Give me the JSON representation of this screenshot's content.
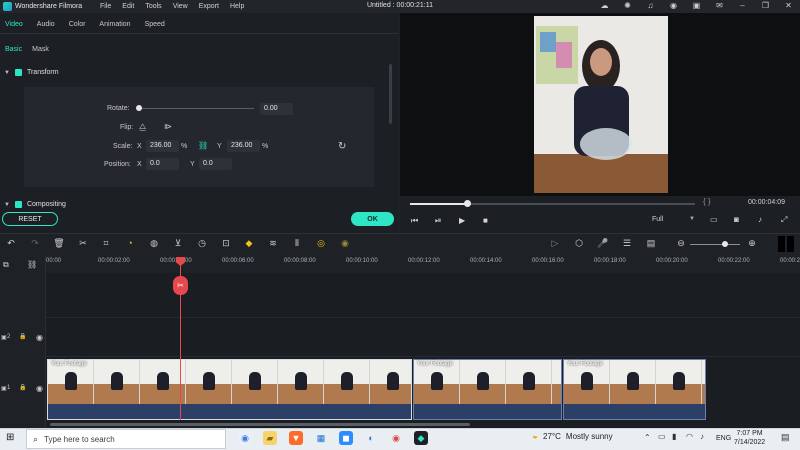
{
  "app": {
    "name": "Wondershare Filmora",
    "title": "Untitled : 00:00:21:11"
  },
  "menu": [
    "File",
    "Edit",
    "Tools",
    "View",
    "Export",
    "Help"
  ],
  "panel": {
    "tabs": [
      "Video",
      "Audio",
      "Color",
      "Animation",
      "Speed"
    ],
    "active_tab": "Video",
    "subtabs": [
      "Basic",
      "Mask"
    ],
    "active_subtab": "Basic",
    "transform_label": "Transform",
    "rotate_label": "Rotate:",
    "rotate_value": "0.00",
    "flip_label": "Flip:",
    "scale_label": "Scale:",
    "scale_x_label": "X",
    "scale_x": "236.00",
    "scale_y_label": "Y",
    "scale_y": "236.00",
    "percent": "%",
    "position_label": "Position:",
    "pos_x_label": "X",
    "pos_x": "0.0",
    "pos_y_label": "Y",
    "pos_y": "0.0",
    "compositing_label": "Compositing",
    "reset_label": "RESET",
    "ok_label": "OK"
  },
  "player": {
    "timecode": "00:00:04:09",
    "braces": "{     }",
    "quality": "Full",
    "progress": 0.2
  },
  "timeline": {
    "ticks": [
      "00:00",
      "00:00:02:00",
      "00:00:04:00",
      "00:00:06:00",
      "00:00:08:00",
      "00:00:10:00",
      "00:00:12:00",
      "00:00:14:00",
      "00:00:16:00",
      "00:00:18:00",
      "00:00:20:00",
      "00:00:22:00",
      "00:00:24:00"
    ],
    "clip_label": "Your Footage",
    "track2_label": "2",
    "track1_label": "1"
  },
  "taskbar": {
    "search_placeholder": "Type here to search",
    "temperature": "27°C",
    "weather": "Mostly sunny",
    "lang": "ENG",
    "time": "7:07 PM",
    "date": "7/14/2022"
  },
  "colors": {
    "accent": "#2ee6c6",
    "playhead": "#e5484d",
    "bg": "#1e2126"
  }
}
